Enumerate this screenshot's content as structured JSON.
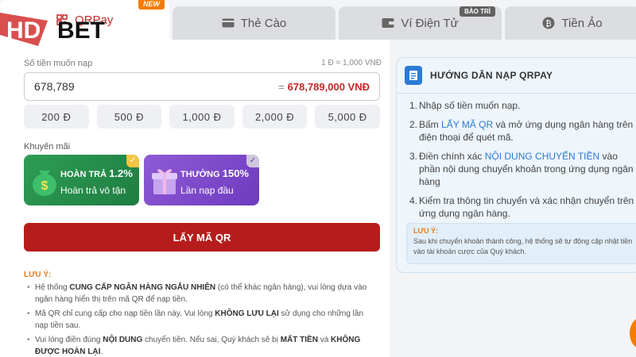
{
  "tabs": [
    {
      "label": "QRPay",
      "badge": "NEW"
    },
    {
      "label": "Thẻ Cào"
    },
    {
      "label": "Ví Điện Tử",
      "badge": "BẢO TRÌ"
    },
    {
      "label": "Tiền Ảo"
    }
  ],
  "logo": {
    "text_hd": "HD",
    "text_bet": "BET"
  },
  "deposit": {
    "amount_label": "Số tiền muốn nạp",
    "rate": "1 Đ = 1,000 VNĐ",
    "amount_value": "678,789",
    "total_prefix": "=",
    "total": "678,789,000 VNĐ"
  },
  "quick_amounts": [
    "200 Đ",
    "500 Đ",
    "1,000 Đ",
    "2,000 Đ",
    "5,000 Đ"
  ],
  "promotions": {
    "label": "Khuyến mãi",
    "items": [
      {
        "title": "HOÀN TRẢ",
        "value": "1.2%",
        "subtitle": "Hoàn trả vô tận"
      },
      {
        "title": "THƯỞNG",
        "value": "150%",
        "subtitle": "Lần nạp đầu"
      }
    ]
  },
  "get_qr_label": "LẤY MÃ QR",
  "notes": {
    "title": "LƯU Ý:",
    "items": [
      {
        "pre": "Hệ thống ",
        "bold": "CUNG CẤP NGÂN HÀNG NGẪU NHIÊN",
        "post": " (có thể khác ngân hàng), vui lòng dựa vào ngân hàng hiển thị trên mã QR để nạp tiền."
      },
      {
        "pre": "Mã QR chỉ cung cấp cho nạp tiền lần này. Vui lòng ",
        "bold": "KHÔNG LƯU LẠI",
        "post": " sử dụng cho những lần nạp tiền sau."
      },
      {
        "pre": "Vui lòng điền đúng ",
        "bold": "NỘI DUNG",
        "mid": " chuyển tiền. Nếu sai, Quý khách sẽ bị ",
        "bold2": "MẤT TIỀN",
        "mid2": " và ",
        "bold3": "KHÔNG ĐƯỢC HOÀN LẠI",
        "post": "."
      }
    ]
  },
  "guide": {
    "title": "HƯỚNG DẪN NẠP QRPAY",
    "steps": [
      {
        "num": "1.",
        "pre": "Nhập số tiền muốn nạp.",
        "hl": "",
        "post": ""
      },
      {
        "num": "2.",
        "pre": "Bấm ",
        "hl": "LẤY MÃ QR",
        "post": " và mở ứng dụng ngân hàng trên điện thoại để quét mã."
      },
      {
        "num": "3.",
        "pre": "Điền chính xác ",
        "hl": "NỘI DUNG CHUYỂN TIỀN",
        "post": " vào phần nội dung chuyển khoản trong ứng dụng ngân hàng"
      },
      {
        "num": "4.",
        "pre": "Kiểm tra thông tin chuyển và xác nhận chuyển trên ứng dụng ngân hàng.",
        "hl": "",
        "post": ""
      }
    ],
    "note_title": "LƯU Ý:",
    "note_text": "Sau khi chuyển khoản thành công, hệ thống sẽ tự động cập nhật tiền vào tài khoản cược của Quý khách."
  },
  "colors": {
    "brand_red": "#b71c1c",
    "accent_blue": "#2b7bd6",
    "promo_green": "#2e9d55",
    "promo_purple": "#8e5ad6"
  }
}
